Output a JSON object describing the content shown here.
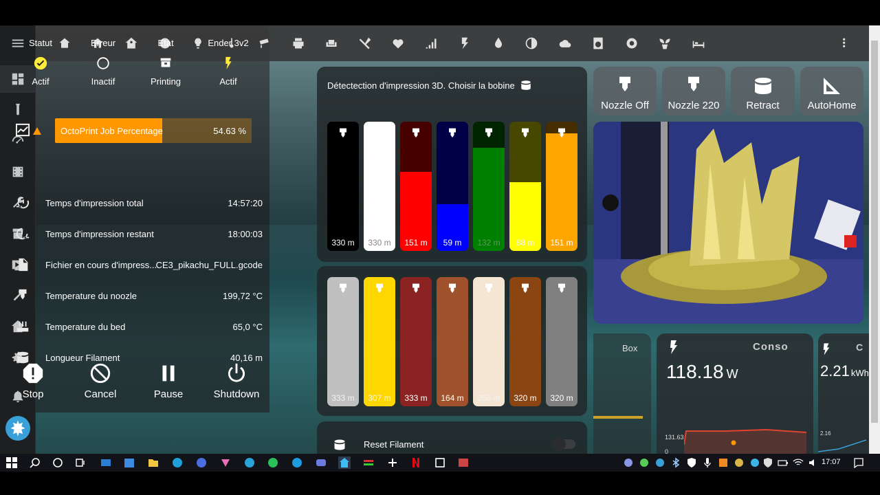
{
  "status": {
    "columns": [
      {
        "title": "Statut",
        "value": "Actif",
        "icon": "check-circle-icon"
      },
      {
        "title": "Erreur",
        "value": "Inactif",
        "icon": "circle-outline-icon"
      },
      {
        "title": "Etat",
        "value": "Printing",
        "icon": "printer-3d-icon"
      },
      {
        "title": "Ender 3v2",
        "value": "Actif",
        "icon": "flash-icon"
      }
    ],
    "job": {
      "label": "OctoPrint Job Percentage",
      "value": "54.63 %",
      "percent": 54.63
    },
    "rows": [
      {
        "icon": "timer-start-icon",
        "label": "Temps d'impression total",
        "value": "14:57:20"
      },
      {
        "icon": "timer-end-icon",
        "label": "Temps d'impression restant",
        "value": "18:00:03"
      },
      {
        "icon": "file-icon",
        "label": "Fichier en cours d'impress...",
        "value": "CE3_pikachu_FULL.gcode"
      },
      {
        "icon": "nozzle-icon",
        "label": "Temperature du noozle",
        "value": "199,72 °C"
      },
      {
        "icon": "radiator-icon",
        "label": "Temperature du bed",
        "value": "65,0 °C"
      },
      {
        "icon": "spool-icon",
        "label": "Longueur Filament",
        "value": "40,16 m"
      }
    ],
    "actions": [
      {
        "icon": "alert-octagon-icon",
        "label": "Stop"
      },
      {
        "icon": "cancel-icon",
        "label": "Cancel"
      },
      {
        "icon": "pause-icon",
        "label": "Pause"
      },
      {
        "icon": "power-icon",
        "label": "Shutdown"
      }
    ]
  },
  "filament": {
    "title": "Détectection d'impression 3D. Choisir la bobine",
    "top_spools": [
      {
        "color": "#000000",
        "label": "330 m",
        "level": 1.0
      },
      {
        "color": "#ffffff",
        "label": "330 m",
        "level": 1.0
      },
      {
        "color": "#ff0000",
        "label": "151 m",
        "level": 0.61
      },
      {
        "color": "#0000ff",
        "label": "59 m",
        "level": 0.36
      },
      {
        "color": "#008000",
        "label": "132 m",
        "level": 0.8
      },
      {
        "color": "#ffff00",
        "label": "88 m",
        "level": 0.53
      },
      {
        "color": "#ffa500",
        "label": "151 m",
        "level": 0.91
      }
    ],
    "bottom_spools": [
      {
        "color": "#c0c0c0",
        "label": "333 m",
        "level": 1.0
      },
      {
        "color": "#ffd700",
        "label": "307 m",
        "level": 1.0
      },
      {
        "color": "#8b2323",
        "label": "333 m",
        "level": 1.0
      },
      {
        "color": "#a0522d",
        "label": "164 m",
        "level": 1.0
      },
      {
        "color": "#f5e6d3",
        "label": "256 m",
        "level": 1.0
      },
      {
        "color": "#8b4513",
        "label": "320 m",
        "level": 1.0
      },
      {
        "color": "#808080",
        "label": "320 m",
        "level": 1.0
      }
    ],
    "reset_label": "Reset Filament"
  },
  "quick_buttons": [
    {
      "icon": "nozzle-icon",
      "label": "Nozzle Off"
    },
    {
      "icon": "nozzle-icon",
      "label": "Nozzle 220"
    },
    {
      "icon": "spool-icon",
      "label": "Retract"
    },
    {
      "icon": "set-square-icon",
      "label": "AutoHome"
    }
  ],
  "energy": {
    "box_label": "Box",
    "conso_label": "Conso",
    "power_value": "118.18",
    "power_unit": "W",
    "chart_max": "131.63",
    "chart_min": "0",
    "energy_value": "2.21",
    "energy_unit": "kWh",
    "energy_chart_max": "2.16",
    "energy_letter": "C"
  },
  "taskbar": {
    "clock": "17:07"
  },
  "colors": {
    "accent": "#ff9800",
    "status_ok": "#ffeb3b",
    "sidebar_bg": "#1d1f21"
  }
}
